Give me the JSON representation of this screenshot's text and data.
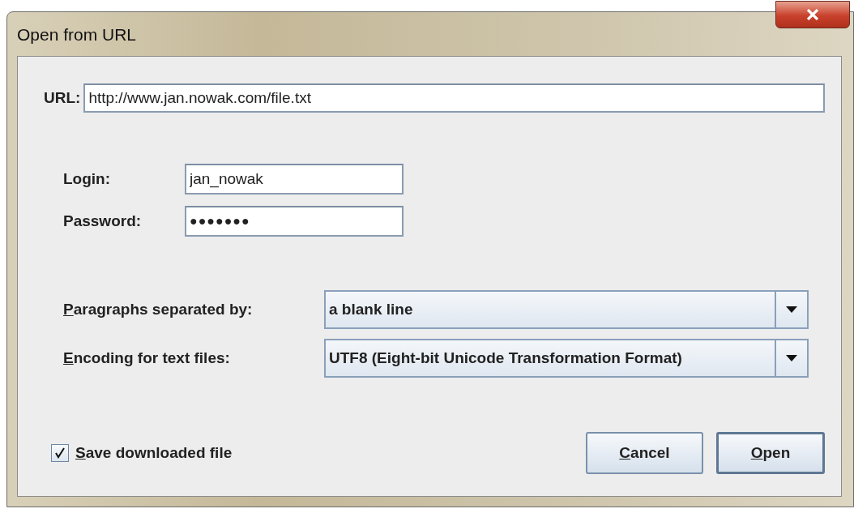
{
  "window": {
    "title": "Open from URL"
  },
  "url": {
    "label": "URL:",
    "value": "http://www.jan.nowak.com/file.txt"
  },
  "credentials": [
    {
      "kind": "text",
      "label": "Login:",
      "value": "jan_nowak"
    },
    {
      "kind": "password",
      "label": "Password:",
      "value": "●●●●●●●"
    }
  ],
  "options": [
    {
      "label": "Paragraphs separated by:",
      "mnemonic": true,
      "value": "a blank line"
    },
    {
      "label": "Encoding for text files:",
      "mnemonic": true,
      "value": "UTF8 (Eight-bit Unicode Transformation Format)"
    }
  ],
  "save_checkbox": {
    "label": "Save downloaded file",
    "mnemonic": true,
    "checked": true
  },
  "buttons": [
    {
      "label": "Cancel",
      "mnemonic": true,
      "default": false
    },
    {
      "label": "Open",
      "mnemonic": true,
      "default": true
    }
  ]
}
